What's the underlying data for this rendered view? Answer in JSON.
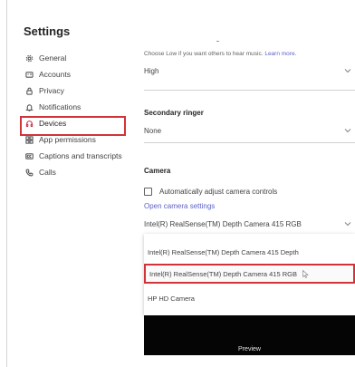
{
  "settings": {
    "title": "Settings"
  },
  "nav": {
    "items": [
      {
        "label": "General",
        "icon": "gear-icon"
      },
      {
        "label": "Accounts",
        "icon": "id-card-icon"
      },
      {
        "label": "Privacy",
        "icon": "lock-icon"
      },
      {
        "label": "Notifications",
        "icon": "bell-icon"
      },
      {
        "label": "Devices",
        "icon": "headset-icon"
      },
      {
        "label": "App permissions",
        "icon": "apps-grid-icon"
      },
      {
        "label": "Captions and transcripts",
        "icon": "cc-icon"
      },
      {
        "label": "Calls",
        "icon": "phone-icon"
      }
    ],
    "active": "Devices"
  },
  "music": {
    "hint_text": "Choose Low if you want others to hear music.",
    "hint_link": "Learn more.",
    "value": "High"
  },
  "secondary_ringer": {
    "title": "Secondary ringer",
    "value": "None"
  },
  "camera": {
    "title": "Camera",
    "auto_adjust_label": "Automatically adjust camera controls",
    "open_settings_label": "Open camera settings",
    "selected": "Intel(R) RealSense(TM) Depth Camera 415 RGB",
    "options": [
      "Intel(R) RealSense(TM) Depth Camera 415 Depth",
      "Intel(R) RealSense(TM) Depth Camera 415 RGB",
      "HP HD Camera"
    ],
    "preview_label": "Preview"
  },
  "colors": {
    "accent": "#5b5fc7",
    "highlight": "#d13438"
  }
}
